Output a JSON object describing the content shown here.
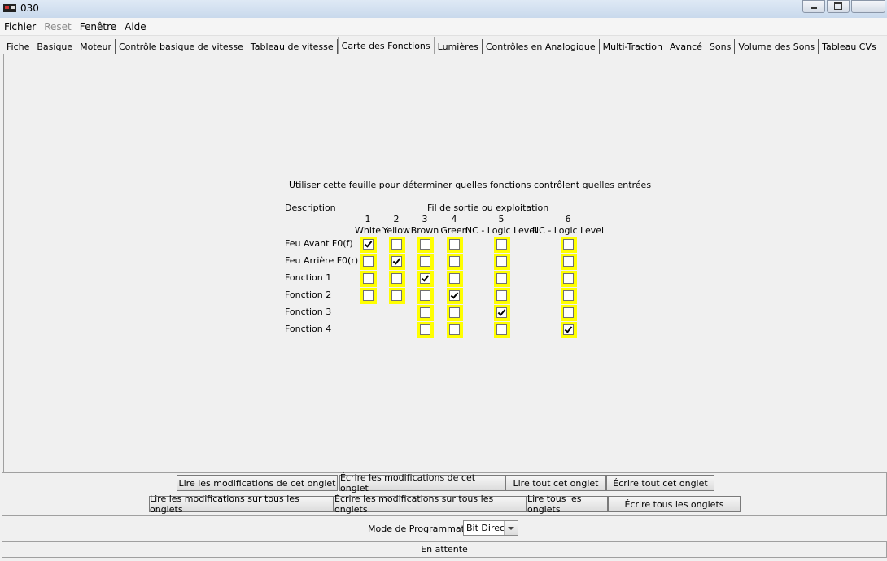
{
  "window": {
    "title": "030"
  },
  "menu": [
    {
      "label": "Fichier",
      "disabled": false
    },
    {
      "label": "Reset",
      "disabled": true
    },
    {
      "label": "Fenêtre",
      "disabled": false
    },
    {
      "label": "Aide",
      "disabled": false
    }
  ],
  "tabs": [
    {
      "label": "Fiche",
      "active": false
    },
    {
      "label": "Basique",
      "active": false
    },
    {
      "label": "Moteur",
      "active": false
    },
    {
      "label": "Contrôle basique de vitesse",
      "active": false
    },
    {
      "label": "Tableau de vitesse",
      "active": false
    },
    {
      "label": "Carte des Fonctions",
      "active": true
    },
    {
      "label": "Lumières",
      "active": false
    },
    {
      "label": "Contrôles en Analogique",
      "active": false
    },
    {
      "label": "Multi-Traction",
      "active": false
    },
    {
      "label": "Avancé",
      "active": false
    },
    {
      "label": "Sons",
      "active": false
    },
    {
      "label": "Volume des Sons",
      "active": false
    },
    {
      "label": "Tableau CVs",
      "active": false
    }
  ],
  "function_map": {
    "instruction": "Utiliser cette feuille pour déterminer quelles fonctions contrôlent quelles entrées",
    "description_header": "Description",
    "outputs_header": "Fil de sortie ou exploitation",
    "outputs": [
      {
        "number": "1",
        "label": "White"
      },
      {
        "number": "2",
        "label": "Yellow"
      },
      {
        "number": "3",
        "label": "Brown"
      },
      {
        "number": "4",
        "label": "Green"
      },
      {
        "number": "5",
        "label": "NC - Logic Level"
      },
      {
        "number": "6",
        "label": "NC - Logic Level"
      }
    ],
    "rows": [
      {
        "label": "Feu Avant F0(f)",
        "cells": [
          true,
          false,
          false,
          false,
          false,
          false
        ]
      },
      {
        "label": "Feu Arrière F0(r)",
        "cells": [
          false,
          true,
          false,
          false,
          false,
          false
        ]
      },
      {
        "label": "Fonction 1",
        "cells": [
          false,
          false,
          true,
          false,
          false,
          false
        ]
      },
      {
        "label": "Fonction 2",
        "cells": [
          false,
          false,
          false,
          true,
          false,
          false
        ]
      },
      {
        "label": "Fonction 3",
        "cells": [
          null,
          null,
          false,
          false,
          true,
          false
        ]
      },
      {
        "label": "Fonction 4",
        "cells": [
          null,
          null,
          false,
          false,
          false,
          true
        ]
      }
    ]
  },
  "buttons_tab": [
    "Lire les modifications de cet onglet",
    "Écrire les modifications de cet onglet",
    "Lire tout cet onglet",
    "Écrire tout cet onglet"
  ],
  "buttons_all": [
    "Lire les modifications sur tous les onglets",
    "Écrire les modifications sur tous les onglets",
    "Lire tous les onglets",
    "Écrire tous les onglets"
  ],
  "programming": {
    "label": "Mode de Programmation",
    "value": "Bit Direct"
  },
  "status": "En attente",
  "colors": {
    "highlight": "#ffff00"
  }
}
